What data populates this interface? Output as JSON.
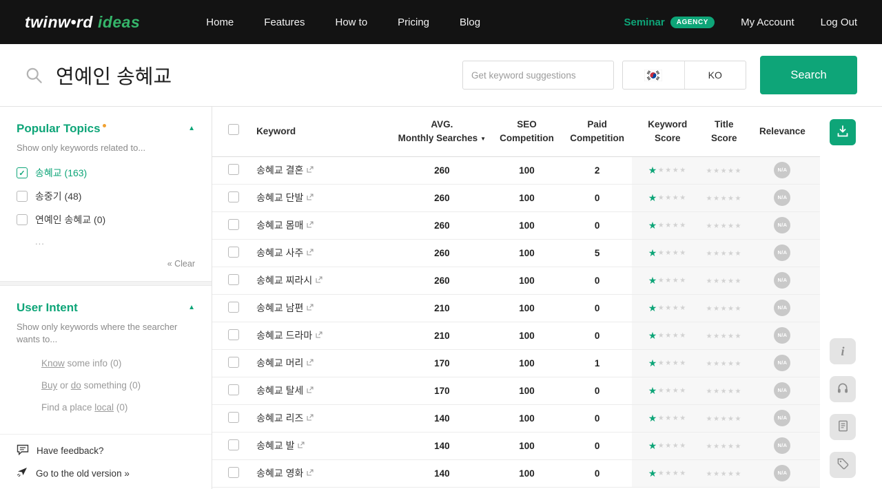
{
  "navbar": {
    "logo": {
      "brand": "twinw•rd",
      "product": "ideas"
    },
    "items": [
      {
        "label": "Home"
      },
      {
        "label": "Features"
      },
      {
        "label": "How to"
      },
      {
        "label": "Pricing"
      },
      {
        "label": "Blog"
      }
    ],
    "seminar": {
      "label": "Seminar",
      "badge": "AGENCY"
    },
    "my_account": "My Account",
    "log_out": "Log Out"
  },
  "search": {
    "query": "연예인 송혜교",
    "placeholder": "Get keyword suggestions",
    "language_code": "KO",
    "flag_icon": "south-korea-flag-icon",
    "button_label": "Search"
  },
  "sidebar": {
    "popular_topics": {
      "title": "Popular Topics",
      "subtitle": "Show only keywords related to...",
      "items": [
        {
          "label": "송혜교",
          "count": "(163)",
          "checked": true
        },
        {
          "label": "송중기",
          "count": "(48)",
          "checked": false
        },
        {
          "label": "연예인 송혜교",
          "count": "(0)",
          "checked": false
        }
      ],
      "more": "...",
      "clear": "« Clear"
    },
    "user_intent": {
      "title": "User Intent",
      "subtitle": "Show only keywords where the searcher wants to...",
      "items": [
        {
          "segments": [
            {
              "t": "Know",
              "u": true
            },
            {
              "t": " some info ",
              "u": false
            }
          ],
          "count": "(0)"
        },
        {
          "segments": [
            {
              "t": "Buy",
              "u": true
            },
            {
              "t": " or ",
              "u": false
            },
            {
              "t": "do",
              "u": true
            },
            {
              "t": " something ",
              "u": false
            }
          ],
          "count": "(0)"
        },
        {
          "segments": [
            {
              "t": "Find a place ",
              "u": false
            },
            {
              "t": "local",
              "u": true
            },
            {
              "t": " ",
              "u": false
            }
          ],
          "count": "(0)"
        }
      ]
    },
    "footer": {
      "feedback": "Have feedback?",
      "old_version": "Go to the old version »"
    }
  },
  "table": {
    "headers": {
      "keyword": "Keyword",
      "avg_line1": "AVG.",
      "avg_line2": "Monthly Searches",
      "seo_line1": "SEO",
      "seo_line2": "Competition",
      "paid_line1": "Paid",
      "paid_line2": "Competition",
      "kscore_line1": "Keyword",
      "kscore_line2": "Score",
      "tscore_line1": "Title",
      "tscore_line2": "Score",
      "relevance": "Relevance"
    },
    "rows": [
      {
        "keyword": "송혜교 결혼",
        "avg_monthly_searches": "260",
        "seo_competition": "100",
        "paid_competition": "2",
        "keyword_score": 1,
        "title_score": 0,
        "relevance": "N/A"
      },
      {
        "keyword": "송혜교 단발",
        "avg_monthly_searches": "260",
        "seo_competition": "100",
        "paid_competition": "0",
        "keyword_score": 1,
        "title_score": 0,
        "relevance": "N/A"
      },
      {
        "keyword": "송혜교 몸매",
        "avg_monthly_searches": "260",
        "seo_competition": "100",
        "paid_competition": "0",
        "keyword_score": 1,
        "title_score": 0,
        "relevance": "N/A"
      },
      {
        "keyword": "송혜교 사주",
        "avg_monthly_searches": "260",
        "seo_competition": "100",
        "paid_competition": "5",
        "keyword_score": 1,
        "title_score": 0,
        "relevance": "N/A"
      },
      {
        "keyword": "송혜교 찌라시",
        "avg_monthly_searches": "260",
        "seo_competition": "100",
        "paid_competition": "0",
        "keyword_score": 1,
        "title_score": 0,
        "relevance": "N/A"
      },
      {
        "keyword": "송혜교 남편",
        "avg_monthly_searches": "210",
        "seo_competition": "100",
        "paid_competition": "0",
        "keyword_score": 1,
        "title_score": 0,
        "relevance": "N/A"
      },
      {
        "keyword": "송혜교 드라마",
        "avg_monthly_searches": "210",
        "seo_competition": "100",
        "paid_competition": "0",
        "keyword_score": 1,
        "title_score": 0,
        "relevance": "N/A"
      },
      {
        "keyword": "송혜교 머리",
        "avg_monthly_searches": "170",
        "seo_competition": "100",
        "paid_competition": "1",
        "keyword_score": 1,
        "title_score": 0,
        "relevance": "N/A"
      },
      {
        "keyword": "송혜교 탈세",
        "avg_monthly_searches": "170",
        "seo_competition": "100",
        "paid_competition": "0",
        "keyword_score": 1,
        "title_score": 0,
        "relevance": "N/A"
      },
      {
        "keyword": "송혜교 리즈",
        "avg_monthly_searches": "140",
        "seo_competition": "100",
        "paid_competition": "0",
        "keyword_score": 1,
        "title_score": 0,
        "relevance": "N/A"
      },
      {
        "keyword": "송혜교 발",
        "avg_monthly_searches": "140",
        "seo_competition": "100",
        "paid_competition": "0",
        "keyword_score": 1,
        "title_score": 0,
        "relevance": "N/A"
      },
      {
        "keyword": "송혜교 영화",
        "avg_monthly_searches": "140",
        "seo_competition": "100",
        "paid_competition": "0",
        "keyword_score": 1,
        "title_score": 0,
        "relevance": "N/A"
      }
    ]
  },
  "right_rail": {
    "download_icon": "download-icon",
    "helper_icons": [
      "info-icon",
      "headset-icon",
      "document-icon",
      "tag-icon"
    ]
  },
  "icons": {
    "sort_desc": "▼",
    "collapse": "▲",
    "check": "✓",
    "star": "★"
  },
  "colors": {
    "accent": "#0ea578",
    "navbar_bg": "#131313",
    "star_inactive": "#d2d2d2",
    "shade_bg": "#f7f7f7",
    "na_badge": "#c9c9c9"
  }
}
